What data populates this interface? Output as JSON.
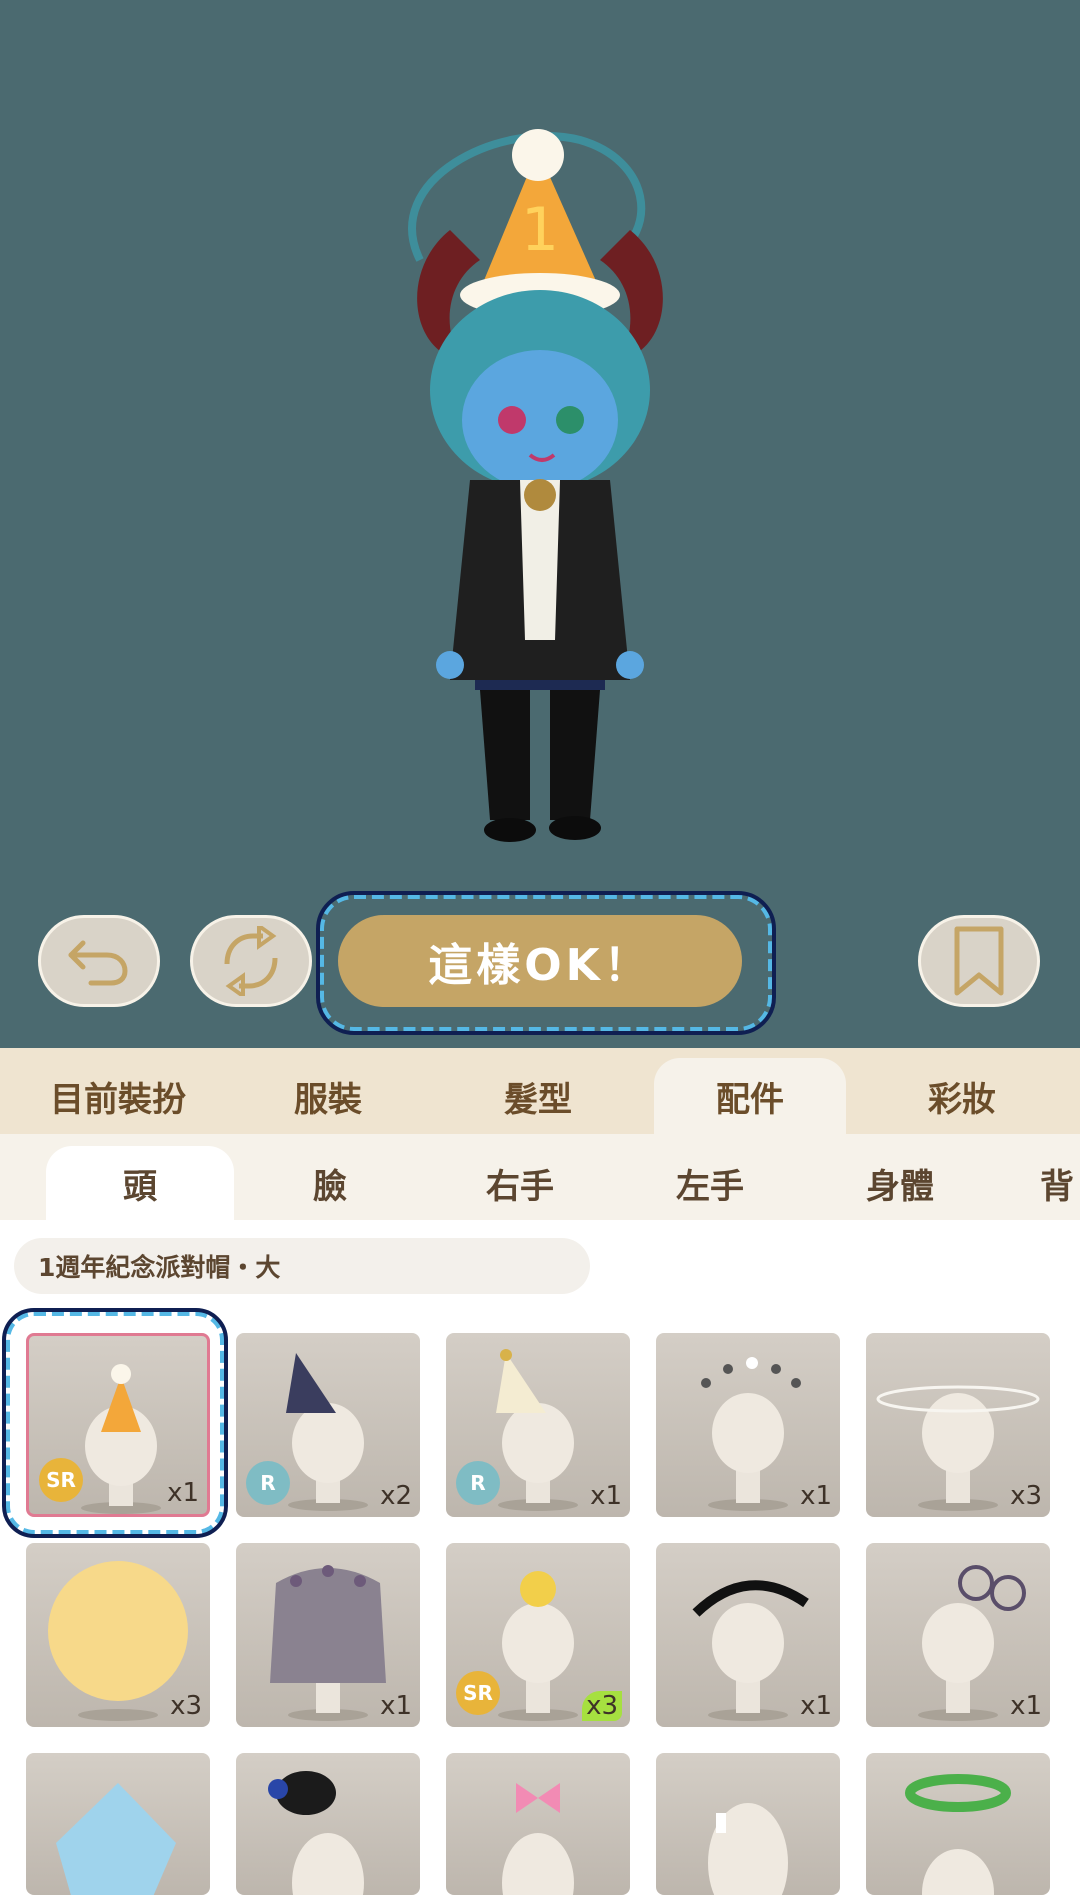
{
  "toolbar": {
    "undo_icon": "undo-arrow-icon",
    "rotate_icon": "rotate-icon",
    "ok_label": "這樣OK！",
    "bookmark_icon": "bookmark-icon"
  },
  "category_tabs": [
    "目前裝扮",
    "服裝",
    "髮型",
    "配件",
    "彩妝"
  ],
  "active_category": "配件",
  "sub_tabs": [
    "頭",
    "臉",
    "右手",
    "左手",
    "身體",
    "背"
  ],
  "active_sub_tab": "頭",
  "selected_item_name": "1週年紀念派對帽・大",
  "items": [
    {
      "rarity": "SR",
      "qty": "x1",
      "selected": true
    },
    {
      "rarity": "R",
      "qty": "x2"
    },
    {
      "rarity": "R",
      "qty": "x1"
    },
    {
      "rarity": "",
      "qty": "x1"
    },
    {
      "rarity": "",
      "qty": "x3"
    },
    {
      "rarity": "",
      "qty": "x3"
    },
    {
      "rarity": "",
      "qty": "x1"
    },
    {
      "rarity": "SR",
      "qty": "x3",
      "new": true
    },
    {
      "rarity": "",
      "qty": "x1"
    },
    {
      "rarity": "",
      "qty": "x1"
    },
    {
      "rarity": "",
      "qty": ""
    },
    {
      "rarity": "",
      "qty": ""
    },
    {
      "rarity": "",
      "qty": ""
    },
    {
      "rarity": "",
      "qty": ""
    },
    {
      "rarity": "",
      "qty": ""
    }
  ]
}
